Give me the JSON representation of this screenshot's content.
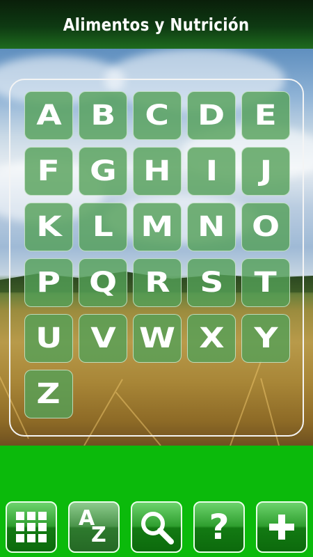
{
  "header": {
    "title": "Alimentos y Nutrición"
  },
  "letters": [
    "A",
    "B",
    "C",
    "D",
    "E",
    "F",
    "G",
    "H",
    "I",
    "J",
    "K",
    "L",
    "M",
    "N",
    "O",
    "P",
    "Q",
    "R",
    "S",
    "T",
    "U",
    "V",
    "W",
    "X",
    "Y",
    "Z"
  ],
  "toolbar": {
    "buttons": [
      {
        "name": "categories-grid-button",
        "icon": "grid-icon"
      },
      {
        "name": "alphabetical-button",
        "icon": "az-sort-icon",
        "label_a": "A",
        "label_z": "Z",
        "active": true
      },
      {
        "name": "search-button",
        "icon": "search-icon"
      },
      {
        "name": "help-button",
        "icon": "help-icon",
        "label": "?"
      },
      {
        "name": "add-button",
        "icon": "plus-icon"
      }
    ]
  },
  "colors": {
    "header_dark": "#0a1f0a",
    "tile_green": "#54a058",
    "bottom_bar": "#0bba0b"
  }
}
